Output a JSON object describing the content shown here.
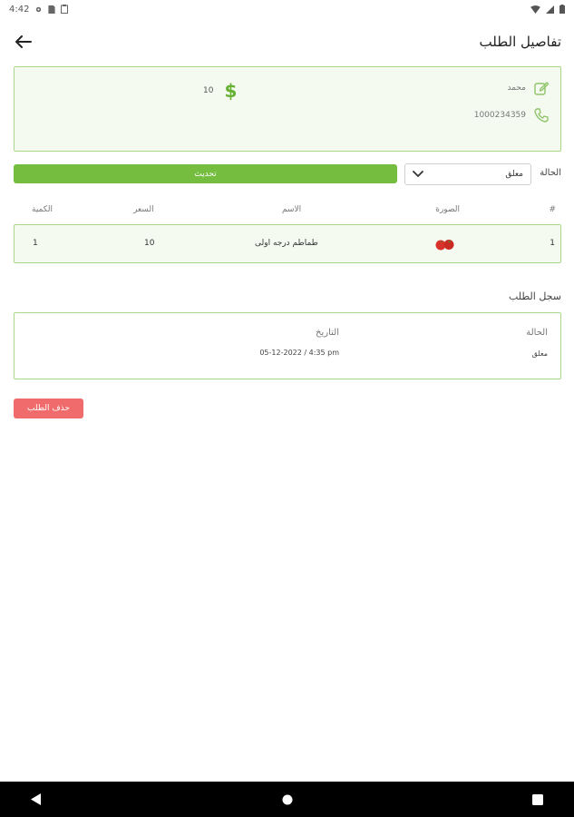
{
  "status_bar": {
    "time": "4:42"
  },
  "app_bar": {
    "title": "تفاصيل الطلب"
  },
  "customer": {
    "name": "محمد",
    "phone": "1000234359",
    "total": "10",
    "currency_symbol": "$"
  },
  "order_status": {
    "label": "الحالة",
    "selected": "معلق",
    "update_label": "تحديث"
  },
  "items_table": {
    "headers": {
      "hash": "#",
      "image": "الصورة",
      "name": "الاسم",
      "price": "السعر",
      "qty": "الكمية"
    },
    "rows": [
      {
        "index": "1",
        "name": "طماطم درجه اولى",
        "price": "10",
        "qty": "1"
      }
    ]
  },
  "order_log": {
    "title": "سجل الطلب",
    "headers": {
      "status": "الحالة",
      "date": "التاريخ"
    },
    "entries": [
      {
        "status": "معلق",
        "date": "05-12-2022 / 4:35 pm"
      }
    ]
  },
  "actions": {
    "delete_label": "حذف الطلب"
  },
  "colors": {
    "accent_green": "#74bd3f",
    "card_border": "#a9d88b",
    "card_bg": "#f5faf1",
    "delete_red": "#f06b6b"
  },
  "icons": {
    "back": "arrow-left-icon",
    "name": "edit-icon",
    "phone": "phone-icon",
    "total": "dollar-icon",
    "dropdown": "chevron-down-icon"
  }
}
